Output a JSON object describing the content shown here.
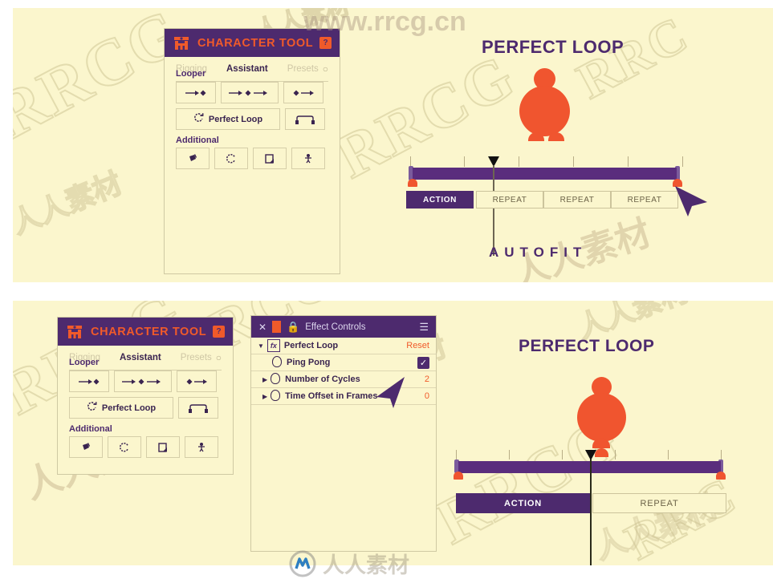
{
  "watermarks": {
    "top_url": "www.rrcg.cn",
    "brand": "RRCG",
    "chinese": "人人素材"
  },
  "panels": {
    "top": {
      "character_tool": {
        "logo_icon": "character-rig-icon",
        "title": "CHARACTER TOOL",
        "help_label": "?",
        "tabs": [
          {
            "label": "Rigging",
            "active": false
          },
          {
            "label": "Assistant",
            "active": true
          },
          {
            "label": "Presets",
            "active": false
          }
        ],
        "gear_icon": "gear-icon",
        "sections": [
          {
            "title": "Looper",
            "rows": [
              [
                {
                  "label": "",
                  "icon": "loop-in-icon",
                  "wide": false
                },
                {
                  "label": "",
                  "icon": "loop-both-icon",
                  "wide": true
                },
                {
                  "label": "",
                  "icon": "loop-out-icon",
                  "wide": false
                }
              ],
              [
                {
                  "label": "Perfect Loop",
                  "icon": "refresh-loop-icon",
                  "wide": true
                },
                {
                  "label": "",
                  "icon": "bridge-loop-icon",
                  "wide": false
                }
              ]
            ]
          },
          {
            "title": "Additional",
            "rows": [
              [
                {
                  "label": "",
                  "icon": "paint-bucket-icon",
                  "wide": false
                },
                {
                  "label": "",
                  "icon": "spinner-icon",
                  "wide": false
                },
                {
                  "label": "",
                  "icon": "page-curl-icon",
                  "wide": false
                },
                {
                  "label": "",
                  "icon": "puppet-pin-icon",
                  "wide": false
                }
              ]
            ]
          }
        ]
      },
      "illustration": {
        "title": "PERFECT LOOP",
        "caption": "AUTOFIT",
        "character_icon": "orange-character-figure",
        "cursor_icon": "arrow-cursor-icon",
        "timeline": {
          "ticks": 6,
          "playhead_icon": "playhead-icon",
          "keyframe_icon": "keyframe-marker-icon",
          "segments": [
            {
              "label": "ACTION",
              "active": true
            },
            {
              "label": "REPEAT",
              "active": false
            },
            {
              "label": "REPEAT",
              "active": false
            },
            {
              "label": "REPEAT",
              "active": false
            }
          ]
        }
      }
    },
    "bottom": {
      "character_tool": {
        "logo_icon": "character-rig-icon",
        "title": "CHARACTER TOOL",
        "help_label": "?",
        "tabs": [
          {
            "label": "Rigging",
            "active": false
          },
          {
            "label": "Assistant",
            "active": true
          },
          {
            "label": "Presets",
            "active": false
          }
        ],
        "gear_icon": "gear-icon",
        "sections": [
          {
            "title": "Looper",
            "rows": [
              [
                {
                  "label": "",
                  "icon": "loop-in-icon",
                  "wide": false
                },
                {
                  "label": "",
                  "icon": "loop-both-icon",
                  "wide": true
                },
                {
                  "label": "",
                  "icon": "loop-out-icon",
                  "wide": false
                }
              ],
              [
                {
                  "label": "Perfect Loop",
                  "icon": "refresh-loop-icon",
                  "wide": true
                },
                {
                  "label": "",
                  "icon": "bridge-loop-icon",
                  "wide": false
                }
              ]
            ]
          },
          {
            "title": "Additional",
            "rows": [
              [
                {
                  "label": "",
                  "icon": "paint-bucket-icon",
                  "wide": false
                },
                {
                  "label": "",
                  "icon": "spinner-icon",
                  "wide": false
                },
                {
                  "label": "",
                  "icon": "page-curl-icon",
                  "wide": false
                },
                {
                  "label": "",
                  "icon": "puppet-pin-icon",
                  "wide": false
                }
              ]
            ]
          }
        ]
      },
      "effect_controls": {
        "close_icon": "close-icon",
        "color_swatch": "comp-color-swatch",
        "lock_icon": "lock-icon",
        "title": "Effect Controls",
        "menu_icon": "panel-menu-icon",
        "effect": {
          "disclosure_icon": "triangle-down-icon",
          "fx_icon": "fx-icon",
          "name": "Perfect Loop",
          "reset_label": "Reset"
        },
        "properties": [
          {
            "disclosure": "",
            "stopwatch_icon": "stopwatch-icon",
            "name": "Ping Pong",
            "value": "",
            "checkbox": true
          },
          {
            "disclosure": "triangle-right-icon",
            "stopwatch_icon": "stopwatch-icon",
            "name": "Number of Cycles",
            "value": "2",
            "checkbox": false
          },
          {
            "disclosure": "triangle-right-icon",
            "stopwatch_icon": "stopwatch-icon",
            "name": "Time Offset in Frames",
            "value": "0",
            "checkbox": false
          }
        ],
        "cursor_icon": "arrow-cursor-icon"
      },
      "illustration": {
        "title": "PERFECT LOOP",
        "character_icon": "orange-character-figure",
        "timeline": {
          "ticks": 6,
          "playhead_icon": "playhead-icon",
          "keyframe_icon": "keyframe-marker-icon",
          "segments": [
            {
              "label": "ACTION",
              "active": true
            },
            {
              "label": "REPEAT",
              "active": false
            }
          ]
        }
      }
    }
  },
  "colors": {
    "background": "#fbf6cd",
    "purple": "#4d2a6e",
    "purple_light": "#5a2d7d",
    "orange": "#f0552f",
    "orange_accent": "#f05a2a",
    "text_muted": "#cfc7a5"
  }
}
